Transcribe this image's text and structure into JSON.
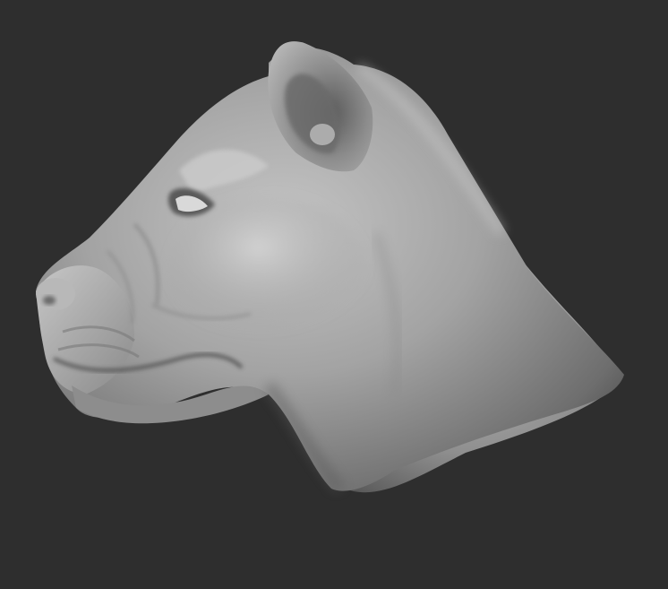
{
  "scene": {
    "subject": "sculpted-lioness-head",
    "view": "left-profile",
    "background_color": "#2e2e2e",
    "material_color": "#9a9a9a"
  }
}
